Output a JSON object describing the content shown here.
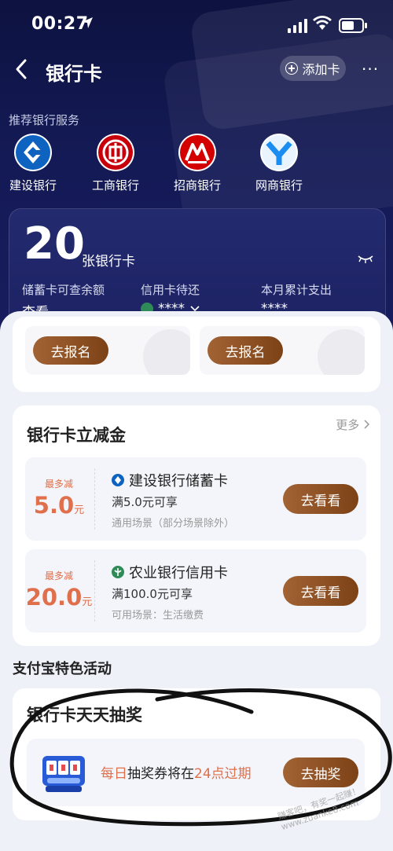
{
  "status_bar": {
    "time": "00:27"
  },
  "nav": {
    "title": "银行卡",
    "add_card_label": "添加卡",
    "more_label": "···"
  },
  "recommend": {
    "title": "推荐银行服务",
    "banks": [
      {
        "name": "建设银行",
        "color": "#0e63c0"
      },
      {
        "name": "工商银行",
        "color": "#c7000b"
      },
      {
        "name": "招商银行",
        "color": "#d40000"
      },
      {
        "name": "网商银行",
        "color": "#1b8cf0"
      }
    ]
  },
  "summary": {
    "count": "20",
    "count_label": "张银行卡",
    "debit_label": "储蓄卡可查余额",
    "debit_value": "查看",
    "credit_label": "信用卡待还",
    "credit_value": "****",
    "spend_label": "本月累计支出",
    "spend_value": "****"
  },
  "signup": {
    "button_1": "去报名",
    "button_2": "去报名"
  },
  "discount": {
    "title": "银行卡立减金",
    "more_label": "更多",
    "coupons": [
      {
        "max_label": "最多减",
        "amount": "5.0",
        "unit": "元",
        "bank": "建设银行储蓄卡",
        "condition": "满5.0元可享",
        "scene": "通用场景（部分场景除外）",
        "button": "去看看"
      },
      {
        "max_label": "最多减",
        "amount": "20.0",
        "unit": "元",
        "bank": "农业银行信用卡",
        "condition": "满100.0元可享",
        "scene": "可用场景：生活缴费",
        "button": "去看看"
      }
    ]
  },
  "features": {
    "title": "支付宝特色活动"
  },
  "lottery": {
    "title": "银行卡天天抽奖",
    "text_hl1": "每日",
    "text_mid": "抽奖券将在",
    "text_hl2": "24点过期",
    "button": "去抽奖"
  },
  "watermark": "赚客吧，有奖一起赚！ www.zuanke8.com",
  "colors": {
    "accent_gold": "#8b4f22",
    "highlight_orange": "#e06f4b",
    "hero_navy": "#141a55"
  }
}
